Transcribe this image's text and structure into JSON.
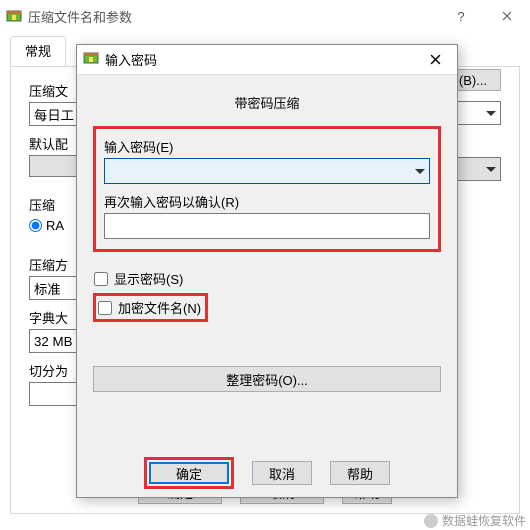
{
  "parent": {
    "title": "压缩文件名和参数",
    "tab_general": "常规",
    "label_archive": "压缩文",
    "input_archive_value": "每日工",
    "label_profile": "默认配",
    "label_format": "压缩",
    "radio_rar": "RA",
    "label_method": "压缩方",
    "method_value": "标准",
    "label_dict": "字典大",
    "dict_value": "32 MB",
    "label_split": "切分为",
    "browse_label": "(B)...",
    "ok": "确定",
    "cancel": "取消",
    "help": "帮助"
  },
  "modal": {
    "title": "输入密码",
    "heading": "带密码压缩",
    "pw_label": "输入密码(E)",
    "pw_confirm_label": "再次输入密码以确认(R)",
    "show_pw": "显示密码(S)",
    "encrypt_names": "加密文件名(N)",
    "organize": "整理密码(O)...",
    "ok": "确定",
    "cancel": "取消",
    "help": "帮助"
  },
  "watermark": "数据蛙恢复软件"
}
